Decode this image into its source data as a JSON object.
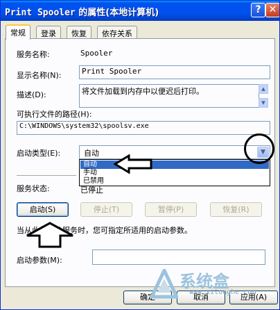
{
  "window": {
    "title_prefix": "Print Spooler",
    "title_suffix": " 的属性(本地计算机)",
    "help_glyph": "?",
    "close_glyph": "✕"
  },
  "tabs": [
    {
      "label": "常规",
      "active": true
    },
    {
      "label": "登录",
      "active": false
    },
    {
      "label": "恢复",
      "active": false
    },
    {
      "label": "依存关系",
      "active": false
    }
  ],
  "general": {
    "service_name_label": "服务名称:",
    "service_name_value": "Spooler",
    "display_name_label": "显示名称(N):",
    "display_name_value": "Print Spooler",
    "description_label": "描述(D):",
    "description_value": "将文件加载到内存中以便迟后打印。",
    "exe_path_label": "可执行文件的路径(H):",
    "exe_path_value": "C:\\WINDOWS\\system32\\spoolsv.exe",
    "startup_type_label": "启动类型(E):",
    "startup_type_value": "自动",
    "startup_type_options": [
      "自动",
      "手动",
      "已禁用"
    ],
    "startup_type_selected_index": 0,
    "service_status_label": "服务状态:",
    "service_status_value": "已停止",
    "buttons": {
      "start": "启动(S)",
      "stop": "停止(T)",
      "pause": "暂停(P)",
      "resume": "恢复(R)"
    },
    "hint_text": "当从此处启动服务时，您可指定所适用的启动参数。",
    "start_params_label": "启动参数(M):",
    "start_params_value": ""
  },
  "footer": {
    "ok": "确定",
    "cancel": "取消",
    "apply": "应用(A)"
  },
  "watermark": {
    "text": "系统盒",
    "url": "www.xitonghe.com"
  },
  "colors": {
    "titlebar": "#0053ee",
    "selection": "#316ac5",
    "dialog_bg": "#ece9d8"
  }
}
